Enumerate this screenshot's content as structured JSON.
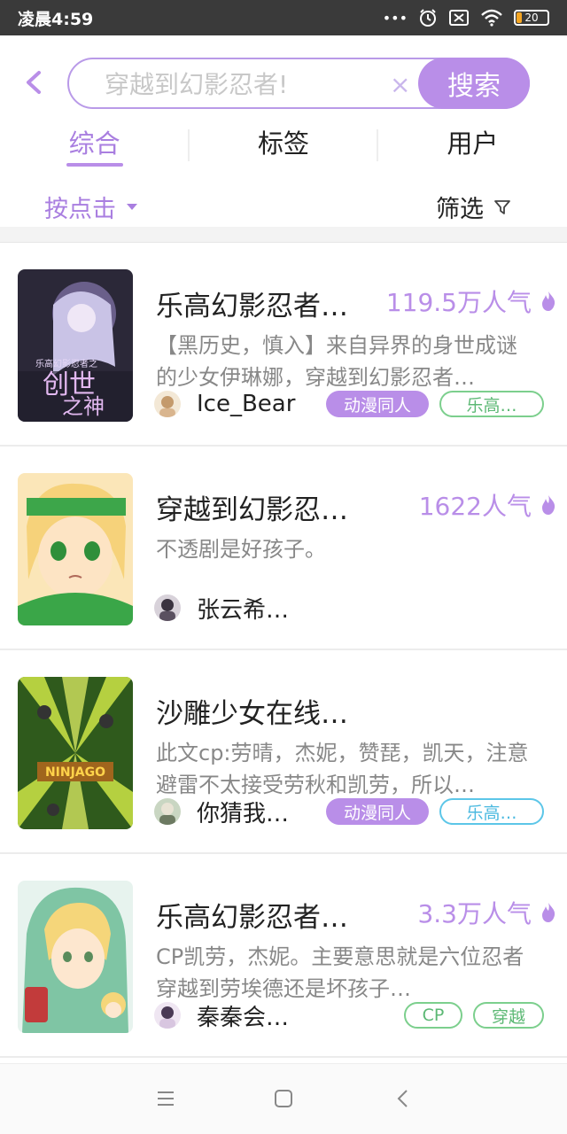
{
  "status_bar": {
    "time": "凌晨4:59",
    "battery": "20"
  },
  "search": {
    "placeholder": "穿越到幻影忍者!",
    "clear": "×",
    "button": "搜索"
  },
  "tabs": [
    {
      "label": "综合",
      "active": true
    },
    {
      "label": "标签",
      "active": false
    },
    {
      "label": "用户",
      "active": false
    }
  ],
  "filters": {
    "sort_label": "按点击",
    "filter_label": "筛选"
  },
  "accent_color": "#b98ee8",
  "results": [
    {
      "title": "乐高幻影忍者…",
      "popularity": "119.5万人气",
      "description": "【黑历史，慎入】来自异界的身世成谜的少女伊琳娜，穿越到幻影忍者…",
      "author": "Ice_Bear",
      "tags": [
        "动漫同人",
        "乐高…"
      ]
    },
    {
      "title": "穿越到幻影忍…",
      "popularity": "1622人气",
      "description": "不透剧是好孩子。",
      "author": "张云希…",
      "tags": []
    },
    {
      "title": "沙雕少女在线…",
      "popularity": "",
      "description": "此文cp:劳晴，杰妮，赞琵，凯天，注意避雷不太接受劳秋和凯劳，所以…",
      "author": "你猜我…",
      "tags": [
        "动漫同人",
        "乐高…"
      ]
    },
    {
      "title": "乐高幻影忍者…",
      "popularity": "3.3万人气",
      "description": "￼CP￼￼凯劳，杰妮。主要意思就是六位忍者穿越到劳埃德还是坏孩子…",
      "author": "秦秦会…",
      "tags": [
        "CP",
        "穿越"
      ]
    }
  ]
}
